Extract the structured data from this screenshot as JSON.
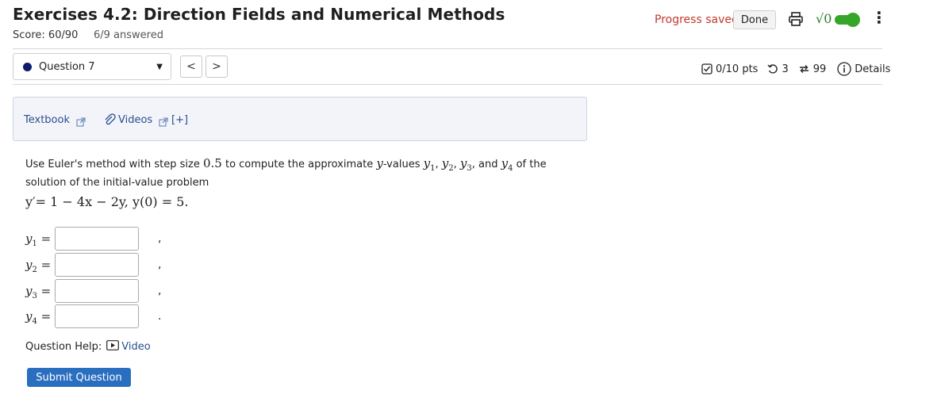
{
  "header": {
    "title": "Exercises 4.2: Direction Fields and Numerical Methods",
    "score": "Score: 60/90",
    "answered": "6/9 answered",
    "progress_text": "Progress saved",
    "done_label": "Done",
    "sqrt_label": "√0"
  },
  "question_nav": {
    "selected": "Question 7",
    "prev": "<",
    "next": ">"
  },
  "status": {
    "points": "0/10 pts",
    "attempts": "3",
    "retries": "99",
    "details": "Details"
  },
  "resources": {
    "textbook": "Textbook",
    "videos": "Videos",
    "more": "[+]"
  },
  "question": {
    "intro": "Use Euler's method with step size",
    "step": "0.5",
    "mid": "to compute the approximate",
    "yvar": "y",
    "mid2": "-values",
    "and": "and",
    "of_the": "of the",
    "line2": "solution of the initial-value problem",
    "equation": "y′= 1 − 4x − 2y,   y(0) = 5."
  },
  "answers": [
    {
      "label": "y",
      "sub": "1",
      "value": "",
      "punct": ","
    },
    {
      "label": "y",
      "sub": "2",
      "value": "",
      "punct": ","
    },
    {
      "label": "y",
      "sub": "3",
      "value": "",
      "punct": ","
    },
    {
      "label": "y",
      "sub": "4",
      "value": "",
      "punct": "."
    }
  ],
  "help": {
    "label": "Question Help:",
    "video": "Video"
  },
  "submit_label": "Submit Question",
  "colors": {
    "accent": "#2a6ec0",
    "progress": "#c0392b",
    "toggle": "#36a62b",
    "link": "#2a4f8f"
  }
}
